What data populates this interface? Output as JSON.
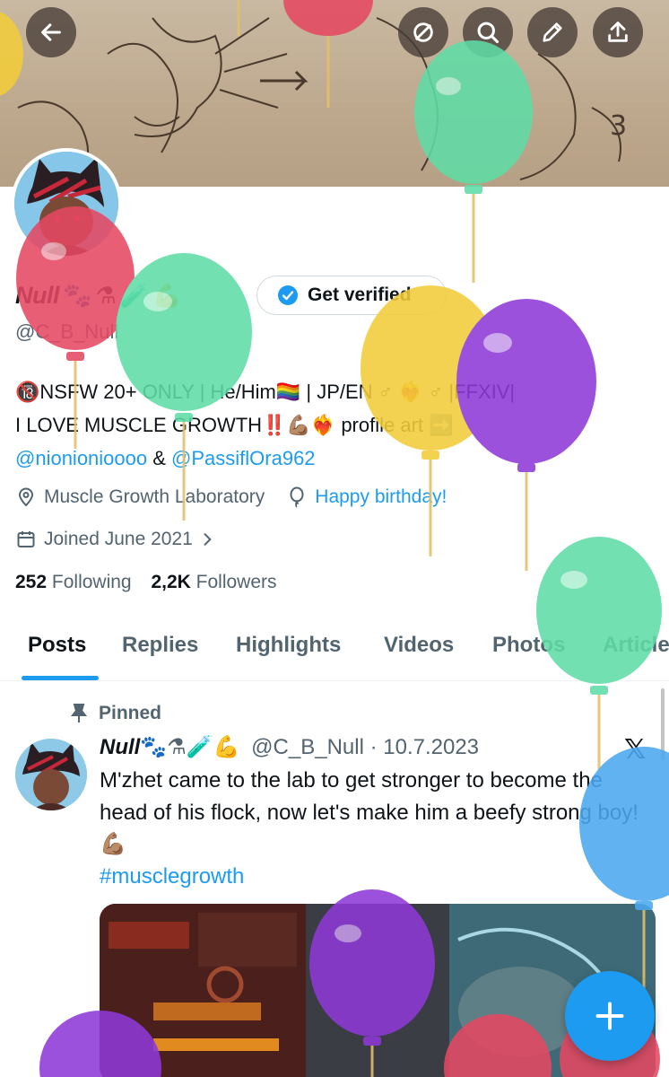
{
  "profile": {
    "display_name": "Null",
    "name_emojis": [
      "🐾",
      "⚗",
      "🧪",
      "💪"
    ],
    "get_verified_label": "Get verified",
    "handle": "@C_B_Null",
    "bio_line1": "🔞NSFW 20+ ONLY | He/Him🏳️‍🌈 | JP/EN ♂ ❤️‍🔥 ♂ |FFXIV|",
    "bio_line2": "I LOVE MUSCLE GROWTH‼️💪🏽❤️‍🔥 profile art ➡️",
    "bio_mention1": "@nionionioooo",
    "bio_amp": " & ",
    "bio_mention2": "@PassiflOra962",
    "location": "Muscle Growth Laboratory",
    "birthday": "Happy birthday!",
    "joined": "Joined June 2021",
    "following_count": "252",
    "following_label": "Following",
    "followers_count": "2,2K",
    "followers_label": "Followers"
  },
  "tabs": [
    {
      "label": "Posts",
      "active": true
    },
    {
      "label": "Replies"
    },
    {
      "label": "Highlights"
    },
    {
      "label": "Videos"
    },
    {
      "label": "Photos"
    },
    {
      "label": "Articles"
    }
  ],
  "post": {
    "pinned_label": "Pinned",
    "name": "Null",
    "name_emojis": "🐾⚗🧪💪",
    "handle": "@C_B_Null",
    "separator": " · ",
    "date": "10.7.2023",
    "text": "M'zhet came to the lab to get stronger to become the head of his flock, now let's make him a beefy strong boy!💪🏽",
    "hashtag": "#musclegrowth"
  },
  "icons": {
    "back": "arrow-left-icon",
    "grok": "slash-circle-icon",
    "search": "search-icon",
    "edit": "pencil-icon",
    "share": "upload-icon",
    "verified": "verified-badge-icon",
    "location": "location-pin-icon",
    "birthday": "balloon-icon",
    "calendar": "calendar-icon",
    "pin": "pin-icon",
    "x": "x-logo-icon",
    "compose": "plus-icon"
  },
  "colors": {
    "accent": "#1d9bf0",
    "text": "#0f1419",
    "secondary": "#536471"
  }
}
